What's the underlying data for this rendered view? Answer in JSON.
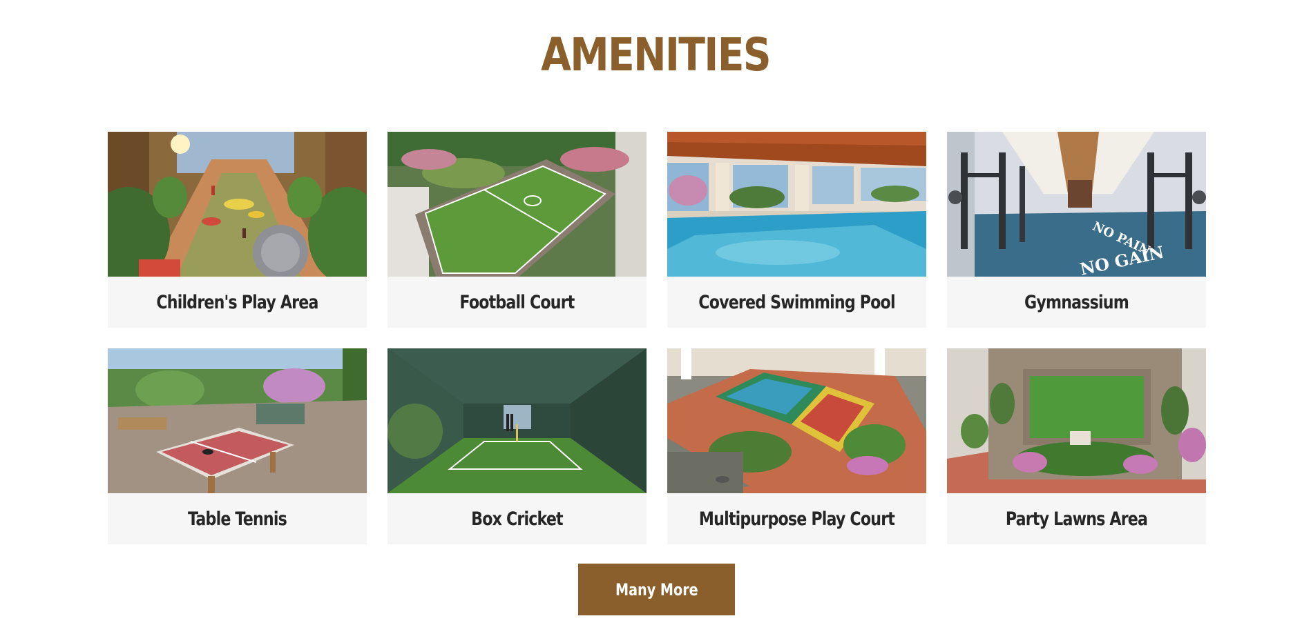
{
  "section": {
    "title": "AMENITIES",
    "more_button_label": "Many More"
  },
  "colors": {
    "accent": "#8a5f2b",
    "card_bg": "#f6f6f6",
    "label_text": "#262626"
  },
  "amenities": [
    {
      "label": "Children's Play Area",
      "image": "children-play-area-photo"
    },
    {
      "label": "Football Court",
      "image": "football-court-photo"
    },
    {
      "label": "Covered Swimming Pool",
      "image": "swimming-pool-photo"
    },
    {
      "label": "Gymnassium",
      "image": "gymnasium-photo",
      "image_text": "NO PAIN NO GAIN"
    },
    {
      "label": "Table Tennis",
      "image": "table-tennis-photo"
    },
    {
      "label": "Box Cricket",
      "image": "box-cricket-photo"
    },
    {
      "label": "Multipurpose Play Court",
      "image": "multipurpose-court-photo"
    },
    {
      "label": "Party Lawns Area",
      "image": "party-lawns-photo"
    }
  ]
}
